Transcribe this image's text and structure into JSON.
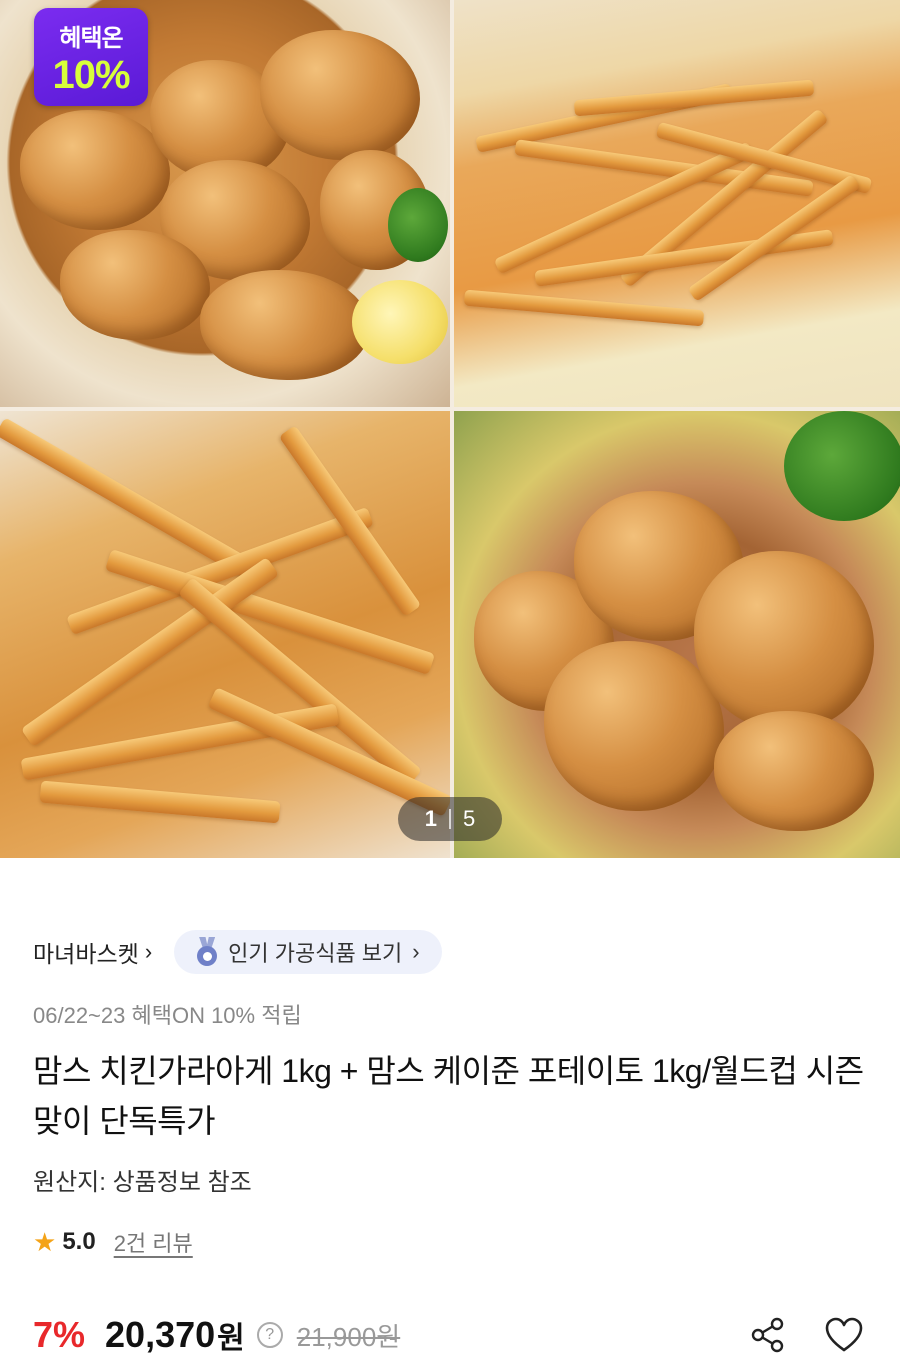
{
  "gallery": {
    "badge": {
      "top": "혜택온",
      "num": "10%"
    },
    "pager": {
      "current": "1",
      "total": "5"
    }
  },
  "shop": {
    "name": "마녀바스켓",
    "chevron": "›"
  },
  "popular_chip": {
    "label": "인기 가공식품 보기",
    "chevron": "›",
    "icon": "medal-icon"
  },
  "benefit_line": "06/22~23 혜택ON 10% 적립",
  "product": {
    "title": "맘스 치킨가라아게 1kg + 맘스 케이준 포테이토 1kg/월드컵 시즌맞이 단독특가",
    "origin": "원산지: 상품정보 참조"
  },
  "rating": {
    "icon": "star-icon",
    "value": "5.0",
    "reviews": "2건 리뷰"
  },
  "price": {
    "discount": "7%",
    "value": "20,370",
    "unit": "원",
    "help": "?",
    "original": "21,900원"
  },
  "actions": {
    "share_icon": "share-icon",
    "like_icon": "heart-icon"
  },
  "colors": {
    "discount": "#e8282b",
    "badge": "#6a22e6",
    "star": "#f4a318",
    "chip_bg": "#eef1fb"
  }
}
